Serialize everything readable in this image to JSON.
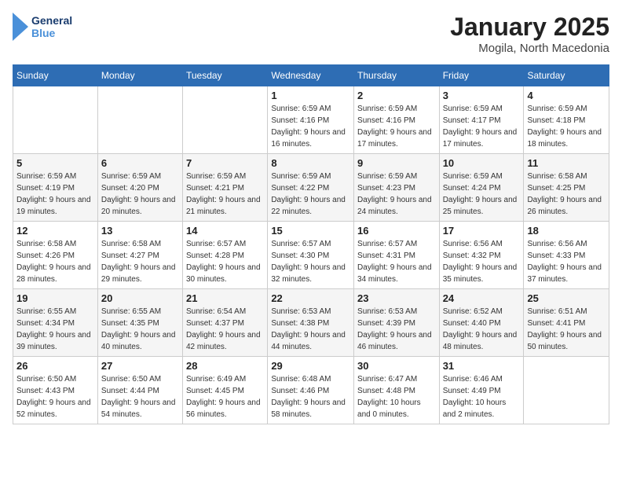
{
  "header": {
    "logo_line1": "General",
    "logo_line2": "Blue",
    "title": "January 2025",
    "subtitle": "Mogila, North Macedonia"
  },
  "weekdays": [
    "Sunday",
    "Monday",
    "Tuesday",
    "Wednesday",
    "Thursday",
    "Friday",
    "Saturday"
  ],
  "weeks": [
    [
      {
        "day": "",
        "sunrise": "",
        "sunset": "",
        "daylight": ""
      },
      {
        "day": "",
        "sunrise": "",
        "sunset": "",
        "daylight": ""
      },
      {
        "day": "",
        "sunrise": "",
        "sunset": "",
        "daylight": ""
      },
      {
        "day": "1",
        "sunrise": "Sunrise: 6:59 AM",
        "sunset": "Sunset: 4:16 PM",
        "daylight": "Daylight: 9 hours and 16 minutes."
      },
      {
        "day": "2",
        "sunrise": "Sunrise: 6:59 AM",
        "sunset": "Sunset: 4:16 PM",
        "daylight": "Daylight: 9 hours and 17 minutes."
      },
      {
        "day": "3",
        "sunrise": "Sunrise: 6:59 AM",
        "sunset": "Sunset: 4:17 PM",
        "daylight": "Daylight: 9 hours and 17 minutes."
      },
      {
        "day": "4",
        "sunrise": "Sunrise: 6:59 AM",
        "sunset": "Sunset: 4:18 PM",
        "daylight": "Daylight: 9 hours and 18 minutes."
      }
    ],
    [
      {
        "day": "5",
        "sunrise": "Sunrise: 6:59 AM",
        "sunset": "Sunset: 4:19 PM",
        "daylight": "Daylight: 9 hours and 19 minutes."
      },
      {
        "day": "6",
        "sunrise": "Sunrise: 6:59 AM",
        "sunset": "Sunset: 4:20 PM",
        "daylight": "Daylight: 9 hours and 20 minutes."
      },
      {
        "day": "7",
        "sunrise": "Sunrise: 6:59 AM",
        "sunset": "Sunset: 4:21 PM",
        "daylight": "Daylight: 9 hours and 21 minutes."
      },
      {
        "day": "8",
        "sunrise": "Sunrise: 6:59 AM",
        "sunset": "Sunset: 4:22 PM",
        "daylight": "Daylight: 9 hours and 22 minutes."
      },
      {
        "day": "9",
        "sunrise": "Sunrise: 6:59 AM",
        "sunset": "Sunset: 4:23 PM",
        "daylight": "Daylight: 9 hours and 24 minutes."
      },
      {
        "day": "10",
        "sunrise": "Sunrise: 6:59 AM",
        "sunset": "Sunset: 4:24 PM",
        "daylight": "Daylight: 9 hours and 25 minutes."
      },
      {
        "day": "11",
        "sunrise": "Sunrise: 6:58 AM",
        "sunset": "Sunset: 4:25 PM",
        "daylight": "Daylight: 9 hours and 26 minutes."
      }
    ],
    [
      {
        "day": "12",
        "sunrise": "Sunrise: 6:58 AM",
        "sunset": "Sunset: 4:26 PM",
        "daylight": "Daylight: 9 hours and 28 minutes."
      },
      {
        "day": "13",
        "sunrise": "Sunrise: 6:58 AM",
        "sunset": "Sunset: 4:27 PM",
        "daylight": "Daylight: 9 hours and 29 minutes."
      },
      {
        "day": "14",
        "sunrise": "Sunrise: 6:57 AM",
        "sunset": "Sunset: 4:28 PM",
        "daylight": "Daylight: 9 hours and 30 minutes."
      },
      {
        "day": "15",
        "sunrise": "Sunrise: 6:57 AM",
        "sunset": "Sunset: 4:30 PM",
        "daylight": "Daylight: 9 hours and 32 minutes."
      },
      {
        "day": "16",
        "sunrise": "Sunrise: 6:57 AM",
        "sunset": "Sunset: 4:31 PM",
        "daylight": "Daylight: 9 hours and 34 minutes."
      },
      {
        "day": "17",
        "sunrise": "Sunrise: 6:56 AM",
        "sunset": "Sunset: 4:32 PM",
        "daylight": "Daylight: 9 hours and 35 minutes."
      },
      {
        "day": "18",
        "sunrise": "Sunrise: 6:56 AM",
        "sunset": "Sunset: 4:33 PM",
        "daylight": "Daylight: 9 hours and 37 minutes."
      }
    ],
    [
      {
        "day": "19",
        "sunrise": "Sunrise: 6:55 AM",
        "sunset": "Sunset: 4:34 PM",
        "daylight": "Daylight: 9 hours and 39 minutes."
      },
      {
        "day": "20",
        "sunrise": "Sunrise: 6:55 AM",
        "sunset": "Sunset: 4:35 PM",
        "daylight": "Daylight: 9 hours and 40 minutes."
      },
      {
        "day": "21",
        "sunrise": "Sunrise: 6:54 AM",
        "sunset": "Sunset: 4:37 PM",
        "daylight": "Daylight: 9 hours and 42 minutes."
      },
      {
        "day": "22",
        "sunrise": "Sunrise: 6:53 AM",
        "sunset": "Sunset: 4:38 PM",
        "daylight": "Daylight: 9 hours and 44 minutes."
      },
      {
        "day": "23",
        "sunrise": "Sunrise: 6:53 AM",
        "sunset": "Sunset: 4:39 PM",
        "daylight": "Daylight: 9 hours and 46 minutes."
      },
      {
        "day": "24",
        "sunrise": "Sunrise: 6:52 AM",
        "sunset": "Sunset: 4:40 PM",
        "daylight": "Daylight: 9 hours and 48 minutes."
      },
      {
        "day": "25",
        "sunrise": "Sunrise: 6:51 AM",
        "sunset": "Sunset: 4:41 PM",
        "daylight": "Daylight: 9 hours and 50 minutes."
      }
    ],
    [
      {
        "day": "26",
        "sunrise": "Sunrise: 6:50 AM",
        "sunset": "Sunset: 4:43 PM",
        "daylight": "Daylight: 9 hours and 52 minutes."
      },
      {
        "day": "27",
        "sunrise": "Sunrise: 6:50 AM",
        "sunset": "Sunset: 4:44 PM",
        "daylight": "Daylight: 9 hours and 54 minutes."
      },
      {
        "day": "28",
        "sunrise": "Sunrise: 6:49 AM",
        "sunset": "Sunset: 4:45 PM",
        "daylight": "Daylight: 9 hours and 56 minutes."
      },
      {
        "day": "29",
        "sunrise": "Sunrise: 6:48 AM",
        "sunset": "Sunset: 4:46 PM",
        "daylight": "Daylight: 9 hours and 58 minutes."
      },
      {
        "day": "30",
        "sunrise": "Sunrise: 6:47 AM",
        "sunset": "Sunset: 4:48 PM",
        "daylight": "Daylight: 10 hours and 0 minutes."
      },
      {
        "day": "31",
        "sunrise": "Sunrise: 6:46 AM",
        "sunset": "Sunset: 4:49 PM",
        "daylight": "Daylight: 10 hours and 2 minutes."
      },
      {
        "day": "",
        "sunrise": "",
        "sunset": "",
        "daylight": ""
      }
    ]
  ]
}
